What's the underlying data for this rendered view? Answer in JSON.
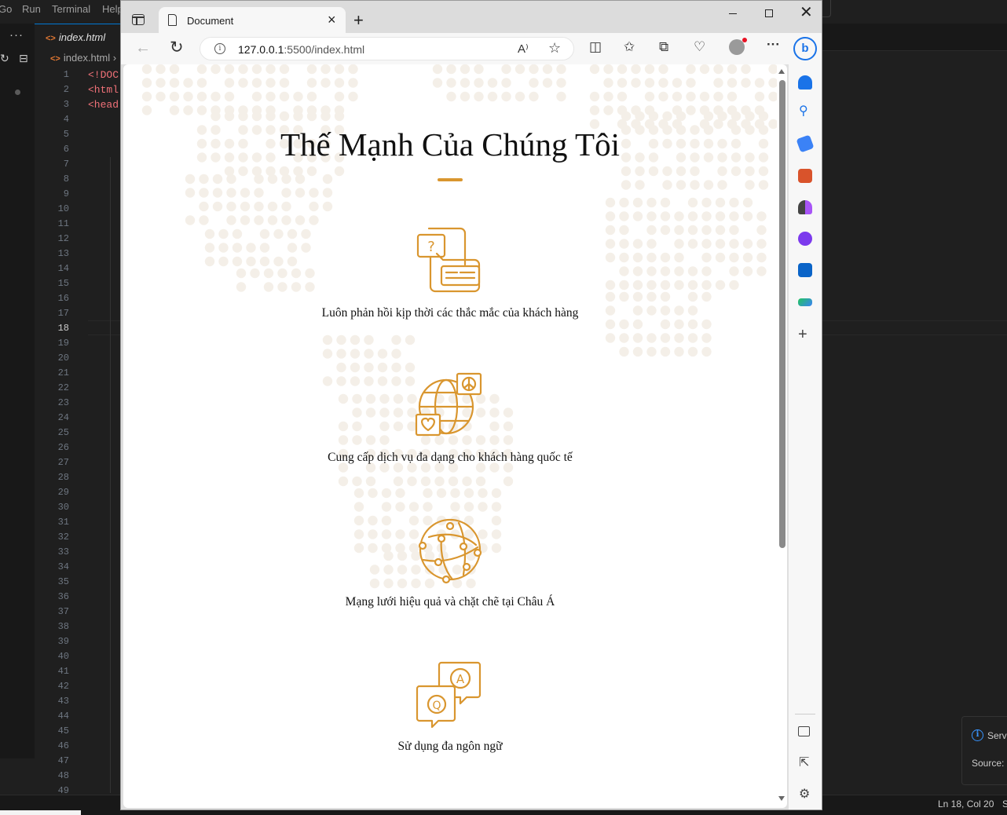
{
  "vscode": {
    "menu": [
      "Go",
      "Run",
      "Terminal",
      "Help"
    ],
    "tab_label": "index.html",
    "breadcrumb": "index.html",
    "code_lines": [
      "<!DOC",
      "<html",
      "<head"
    ],
    "line_numbers": [
      "1",
      "2",
      "3",
      "4",
      "5",
      "6",
      "7",
      "8",
      "9",
      "10",
      "11",
      "12",
      "13",
      "14",
      "15",
      "16",
      "17",
      "18",
      "19",
      "20",
      "21",
      "22",
      "23",
      "24",
      "25",
      "26",
      "27",
      "28",
      "29",
      "30",
      "31",
      "32",
      "33",
      "34",
      "35",
      "36",
      "37",
      "38",
      "39",
      "40",
      "41",
      "42",
      "43",
      "44",
      "45",
      "46",
      "47",
      "48",
      "49"
    ],
    "current_line": "18",
    "status_position": "Ln 18, Col 20",
    "status_extra": "S",
    "toast_title": "Serv",
    "toast_source": "Source: L"
  },
  "browser": {
    "tab_title": "Document",
    "address_host": "127.0.0.1",
    "address_rest": ":5500/index.html",
    "read_aloud_label": "A⁾",
    "bing_label": "b"
  },
  "page": {
    "title": "Thế Mạnh Của Chúng Tôi",
    "accent_color": "#d9962f",
    "features": [
      {
        "icon": "customer-support-chat-icon",
        "label": "Luôn phản hồi kịp thời các thắc mắc của khách hàng"
      },
      {
        "icon": "global-services-icon",
        "label": "Cung cấp dịch vụ đa dạng cho khách hàng quốc tế"
      },
      {
        "icon": "network-globe-icon",
        "label": "Mạng lưới hiệu quả và chặt chẽ tại Châu Á"
      },
      {
        "icon": "multilingual-qa-icon",
        "label": "Sử dụng đa ngôn ngữ"
      }
    ]
  }
}
